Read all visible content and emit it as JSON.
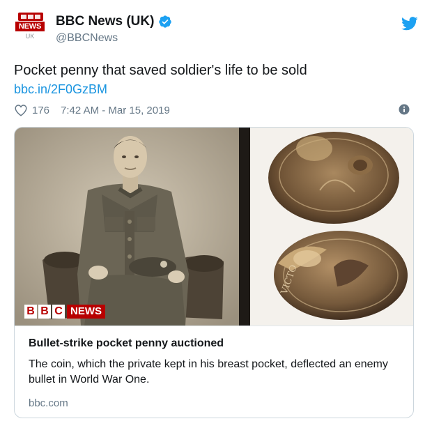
{
  "account": {
    "avatar_top": "BBC",
    "avatar_news": "NEWS",
    "avatar_region": "UK",
    "display_name": "BBC News (UK)",
    "handle": "@BBCNews",
    "verified": true
  },
  "tweet": {
    "text": "Pocket penny that saved soldier's life to be sold",
    "link": "bbc.in/2F0GzBM",
    "likes": "176",
    "time": "7:42 AM - Mar 15, 2019"
  },
  "card": {
    "image_badge": {
      "letters": [
        "B",
        "B",
        "C"
      ],
      "word": "NEWS"
    },
    "title": "Bullet-strike pocket penny auctioned",
    "description": "The coin, which the private kept in his breast pocket, deflected an enemy bullet in World War One.",
    "domain": "bbc.com"
  },
  "icons": {
    "verified": "verified-badge-icon",
    "twitter": "twitter-bird-icon",
    "like": "heart-icon",
    "info": "info-icon"
  },
  "colors": {
    "link": "#1b95e0",
    "muted": "#657786",
    "bbc_red": "#b80000",
    "verified": "#1da1f2"
  }
}
